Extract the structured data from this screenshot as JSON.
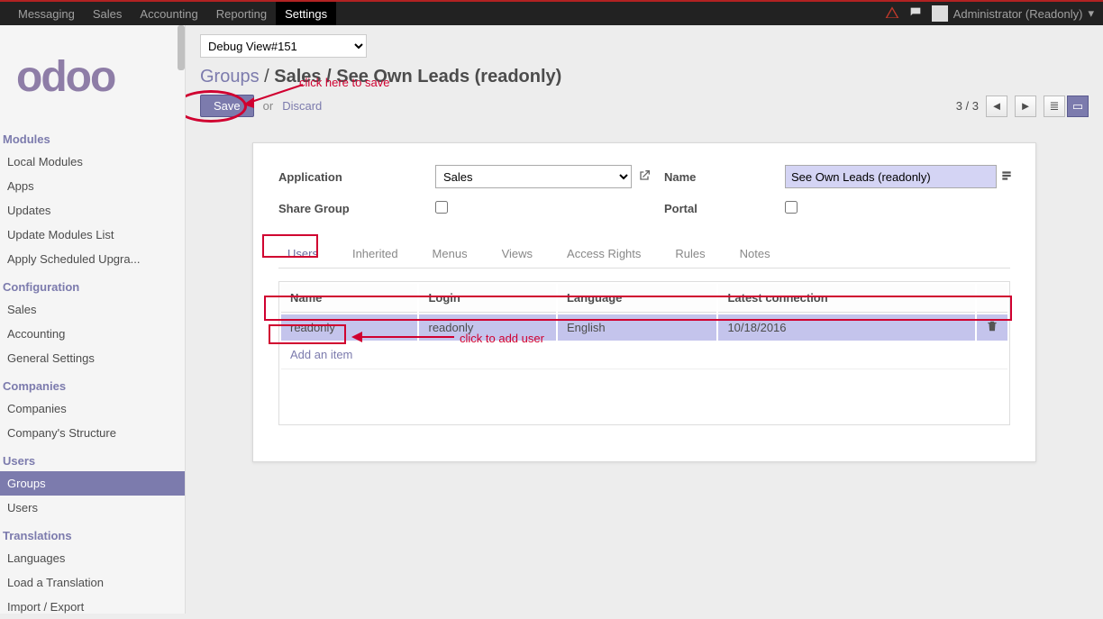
{
  "topnav": {
    "items": [
      "Messaging",
      "Sales",
      "Accounting",
      "Reporting",
      "Settings"
    ],
    "active_index": 4,
    "user": "Administrator (Readonly)"
  },
  "logo": "odoo",
  "sidebar": {
    "sections": [
      {
        "title": "Modules",
        "items": [
          "Local Modules",
          "Apps",
          "Updates",
          "Update Modules List",
          "Apply Scheduled Upgra..."
        ]
      },
      {
        "title": "Configuration",
        "items": [
          "Sales",
          "Accounting",
          "General Settings"
        ]
      },
      {
        "title": "Companies",
        "items": [
          "Companies",
          "Company's Structure"
        ]
      },
      {
        "title": "Users",
        "items": [
          "Groups",
          "Users"
        ],
        "active_index": 0
      },
      {
        "title": "Translations",
        "items": [
          "Languages",
          "Load a Translation",
          "Import / Export"
        ]
      }
    ]
  },
  "debug_view": "Debug View#151",
  "breadcrumb": {
    "root": "Groups",
    "mid": "Sales",
    "leaf": "See Own Leads (readonly)"
  },
  "buttons": {
    "save": "Save",
    "or": "or",
    "discard": "Discard"
  },
  "pager": "3 / 3",
  "form": {
    "application_label": "Application",
    "application_value": "Sales",
    "share_group_label": "Share Group",
    "name_label": "Name",
    "name_value": "See Own Leads (readonly)",
    "portal_label": "Portal"
  },
  "tabs": [
    "Users",
    "Inherited",
    "Menus",
    "Views",
    "Access Rights",
    "Rules",
    "Notes"
  ],
  "table": {
    "headers": [
      "Name",
      "Login",
      "Language",
      "Latest connection"
    ],
    "rows": [
      {
        "name": "readonly",
        "login": "readonly",
        "language": "English",
        "latest": "10/18/2016"
      }
    ],
    "add_item": "Add an item"
  },
  "annotations": {
    "save_hint": "click here to save",
    "add_user_hint": "click to add user"
  }
}
